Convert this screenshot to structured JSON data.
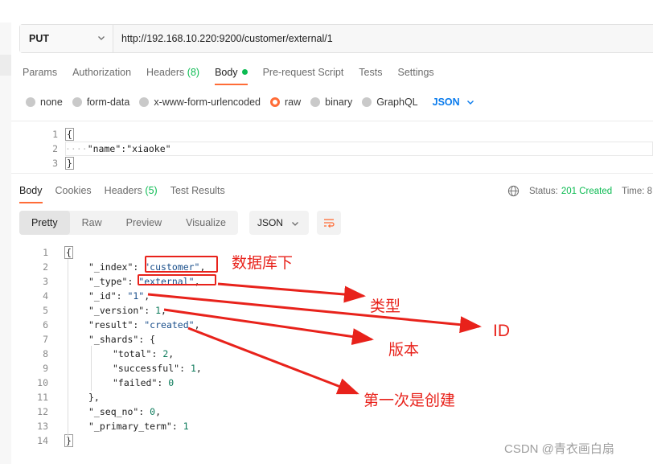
{
  "request": {
    "method": "PUT",
    "url": "http://192.168.10.220:9200/customer/external/1",
    "tabs": [
      {
        "label": "Params"
      },
      {
        "label": "Authorization"
      },
      {
        "label": "Headers",
        "count": "(8)"
      },
      {
        "label": "Body"
      },
      {
        "label": "Pre-request Script"
      },
      {
        "label": "Tests"
      },
      {
        "label": "Settings"
      }
    ],
    "body_types": [
      "none",
      "form-data",
      "x-www-form-urlencoded",
      "raw",
      "binary",
      "GraphQL"
    ],
    "body_format": "JSON",
    "body_lines": [
      "1",
      "2",
      "3"
    ],
    "body_text": {
      "open": "{",
      "key": "\"name\"",
      "colon": ":",
      "value": "\"xiaoke\"",
      "close": "}"
    }
  },
  "response": {
    "tabs": [
      {
        "label": "Body"
      },
      {
        "label": "Cookies"
      },
      {
        "label": "Headers",
        "count": "(5)"
      },
      {
        "label": "Test Results"
      }
    ],
    "status_label": "Status:",
    "status_value": "201 Created",
    "time_label": "Time: 8",
    "view_modes": [
      "Pretty",
      "Raw",
      "Preview",
      "Visualize"
    ],
    "format": "JSON",
    "line_numbers": [
      "1",
      "2",
      "3",
      "4",
      "5",
      "6",
      "7",
      "8",
      "9",
      "10",
      "11",
      "12",
      "13",
      "14"
    ],
    "lines": [
      {
        "k": "",
        "v": "{",
        "t": "p"
      },
      {
        "k": "\"_index\": ",
        "v": "\"customer\"",
        "t": "s",
        "tail": ","
      },
      {
        "k": "\"_type\": ",
        "v": "\"external\"",
        "t": "s",
        "tail": ","
      },
      {
        "k": "\"_id\": ",
        "v": "\"1\"",
        "t": "s",
        "tail": ","
      },
      {
        "k": "\"_version\": ",
        "v": "1",
        "t": "n",
        "tail": ","
      },
      {
        "k": "\"result\": ",
        "v": "\"created\"",
        "t": "s",
        "tail": ","
      },
      {
        "k": "\"_shards\": ",
        "v": "{",
        "t": "p"
      },
      {
        "k": "\"total\": ",
        "v": "2",
        "t": "n",
        "tail": ","
      },
      {
        "k": "\"successful\": ",
        "v": "1",
        "t": "n",
        "tail": ","
      },
      {
        "k": "\"failed\": ",
        "v": "0",
        "t": "n"
      },
      {
        "k": "",
        "v": "},",
        "t": "p"
      },
      {
        "k": "\"_seq_no\": ",
        "v": "0",
        "t": "n",
        "tail": ","
      },
      {
        "k": "\"_primary_term\": ",
        "v": "1",
        "t": "n"
      },
      {
        "k": "",
        "v": "}",
        "t": "p"
      }
    ]
  },
  "annotations": {
    "index_note": "数据库下",
    "type_note": "类型",
    "id_note": "ID",
    "version_note": "版本",
    "result_note": "第一次是创建",
    "color": "#e8221b"
  },
  "watermark": "CSDN @青衣画白扇",
  "colors": {
    "accent": "#ff6c37",
    "success": "#0cbb52",
    "link": "#097bed"
  }
}
